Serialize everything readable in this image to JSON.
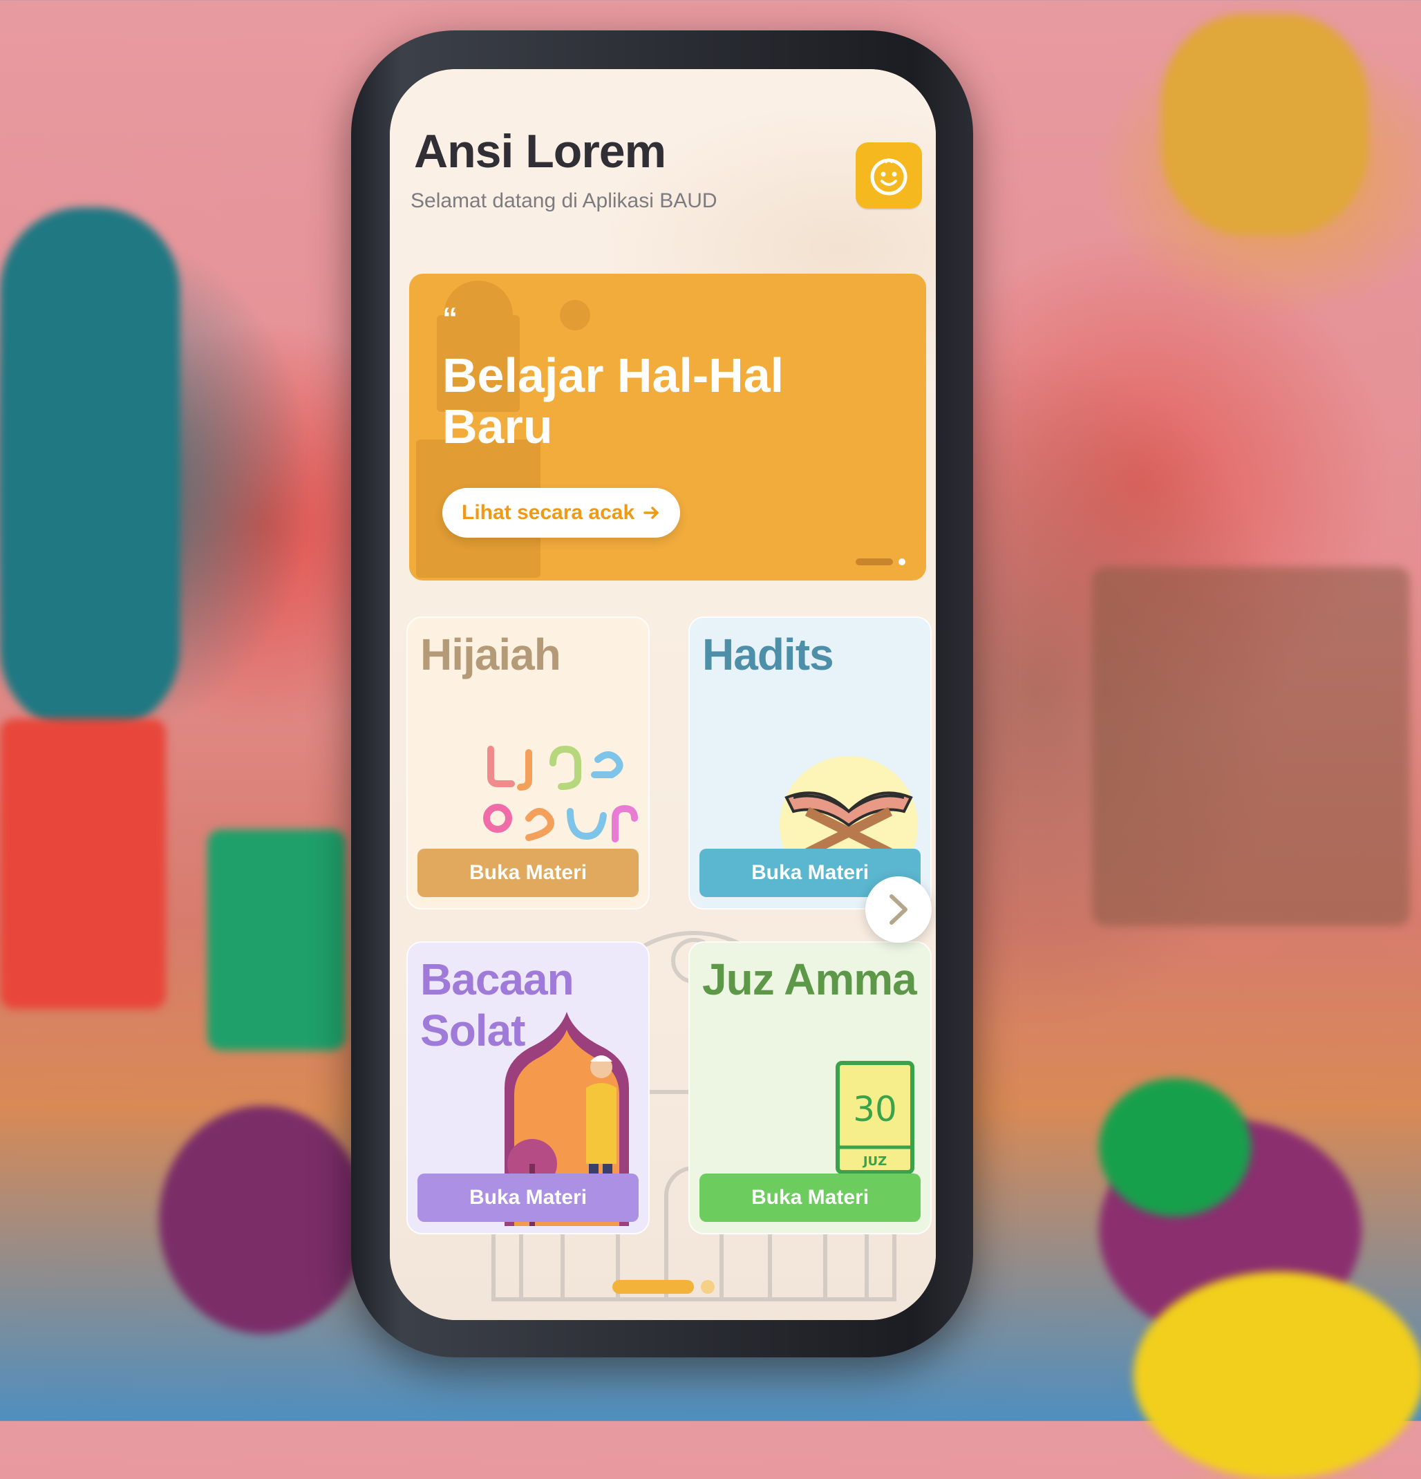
{
  "header": {
    "title": "Ansi Lorem",
    "subtitle": "Selamat datang di Aplikasi BAUD",
    "avatar_icon": "smiley-face-icon"
  },
  "banner": {
    "quote_mark": "“",
    "headline": "Belajar Hal-Hal Baru",
    "cta_label": "Lihat secara acak",
    "cta_icon": "arrow-right-icon",
    "color": "#f2ac3c"
  },
  "cards": [
    {
      "label": "Hijaiah",
      "button": "Buka Materi",
      "icon": "arabic-letters-icon",
      "accent": "#e0a95d"
    },
    {
      "label": "Hadits",
      "button": "Buka Materi",
      "icon": "open-book-stand-icon",
      "accent": "#5bb6cf"
    },
    {
      "label": "Bacaan Solat",
      "button": "Buka Materi",
      "icon": "praying-person-icon",
      "accent": "#ab90e3"
    },
    {
      "label": "Juz Amma",
      "button": "Buka Materi",
      "icon": "juz-30-book-icon",
      "accent": "#6dcc5e",
      "badge_number": "30",
      "badge_text": "JUZ"
    }
  ],
  "navigation": {
    "next_icon": "chevron-right-icon"
  }
}
